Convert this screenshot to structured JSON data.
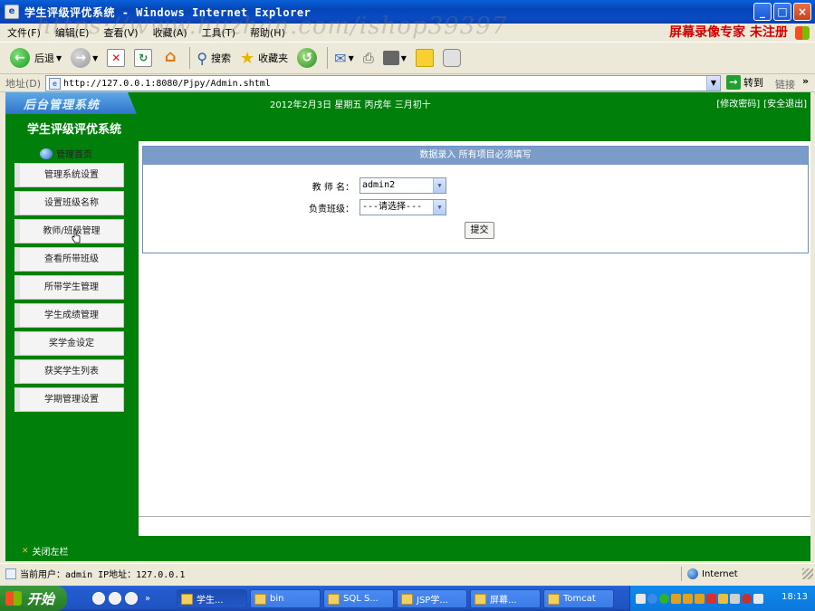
{
  "window": {
    "title": "学生评级评优系统 - Windows Internet Explorer",
    "app_icon": "ie-page-icon",
    "buttons": [
      "_",
      "□",
      "×"
    ]
  },
  "watermark": "https://www.huzhan.com/ishop39397",
  "menubar": {
    "items": [
      "文件(F)",
      "编辑(E)",
      "查看(V)",
      "收藏(A)",
      "工具(T)",
      "帮助(H)"
    ],
    "right_text": "屏幕录像专家 未注册"
  },
  "toolbar": {
    "back_label": "后退",
    "search_label": "搜索",
    "favorites_label": "收藏夹"
  },
  "addressbar": {
    "label": "地址(D)",
    "url": "http://127.0.0.1:8080/Pjpy/Admin.shtml",
    "go_label": "转到",
    "links_label": "链接",
    "more": "»"
  },
  "header": {
    "logo_text": "后台管理系统",
    "system_title": "学生评级评优系统",
    "date": "2012年2月3日 星期五 丙戌年 三月初十",
    "links": [
      "[修改密码]",
      "[安全退出]"
    ]
  },
  "sidebar": {
    "home_label": "管理首页",
    "items": [
      "管理系统设置",
      "设置班级名称",
      "教师/班级管理",
      "查看所带班级",
      "所带学生管理",
      "学生成绩管理",
      "奖学金设定",
      "获奖学生列表",
      "学期管理设置"
    ],
    "close_label": "关闭左栏"
  },
  "form": {
    "heading": "数据录入 所有项目必须填写",
    "teacher_label": "教 师 名：",
    "teacher_value": "admin2",
    "class_label": "负责班级：",
    "class_value": "---请选择---",
    "submit_label": "提交"
  },
  "statusbar": {
    "text": "当前用户：admin  IP地址：127.0.0.1",
    "zone": "Internet"
  },
  "taskbar": {
    "start_label": "开始",
    "tasks": [
      "学生...",
      "bin",
      "SQL S...",
      "JSP学...",
      "屏幕...",
      "Tomcat"
    ],
    "clock": "18:13"
  },
  "colors": {
    "header_green": "#00800a",
    "form_head_blue": "#7b9cc8",
    "title_blue": "#0a4bc4",
    "watermark_red": "#d40000"
  }
}
